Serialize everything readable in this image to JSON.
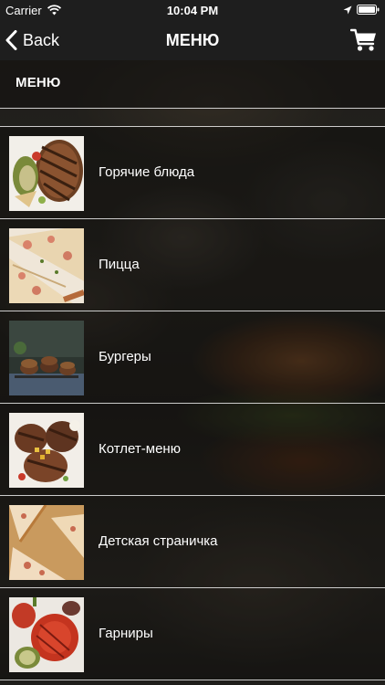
{
  "status_bar": {
    "carrier": "Carrier",
    "time": "10:04 PM",
    "icons": [
      "wifi-icon",
      "location-arrow-icon",
      "battery-icon"
    ]
  },
  "nav": {
    "back_label": "Back",
    "title": "МЕНЮ",
    "cart_icon": "cart-icon"
  },
  "section": {
    "title": "МЕНЮ"
  },
  "menu": {
    "items": [
      {
        "label": "Горячие блюда",
        "thumb": "grilled-steak-photo"
      },
      {
        "label": "Пицца",
        "thumb": "pizza-photo"
      },
      {
        "label": "Бургеры",
        "thumb": "burgers-photo"
      },
      {
        "label": "Котлет-меню",
        "thumb": "cutlet-photo"
      },
      {
        "label": "Детская страничка",
        "thumb": "pizza-slices-photo"
      },
      {
        "label": "Гарниры",
        "thumb": "grilled-vegetables-photo"
      }
    ]
  },
  "colors": {
    "bar_background": "#1e1e1e",
    "text": "#ffffff",
    "divider": "#ebebeb"
  }
}
